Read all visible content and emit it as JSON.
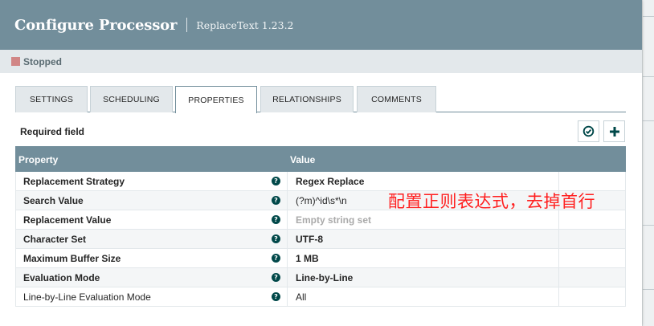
{
  "header": {
    "title": "Configure Processor",
    "subtitle": "ReplaceText 1.23.2"
  },
  "status": {
    "label": "Stopped",
    "color": "#d18686"
  },
  "tabs": [
    {
      "label": "SETTINGS"
    },
    {
      "label": "SCHEDULING"
    },
    {
      "label": "PROPERTIES",
      "active": true
    },
    {
      "label": "RELATIONSHIPS"
    },
    {
      "label": "COMMENTS"
    }
  ],
  "properties_panel": {
    "required_label": "Required field",
    "columns": {
      "property": "Property",
      "value": "Value"
    },
    "rows": [
      {
        "name": "Replacement Strategy",
        "value": "Regex Replace"
      },
      {
        "name": "Search Value",
        "value": "(?m)^id\\s*\\n"
      },
      {
        "name": "Replacement Value",
        "value": "Empty string set"
      },
      {
        "name": "Character Set",
        "value": "UTF-8"
      },
      {
        "name": "Maximum Buffer Size",
        "value": "1 MB"
      },
      {
        "name": "Evaluation Mode",
        "value": "Line-by-Line"
      },
      {
        "name": "Line-by-Line Evaluation Mode",
        "value": "All"
      }
    ]
  },
  "annotation": "配置正则表达式，去掉首行",
  "colors": {
    "header_bg": "#728e9b",
    "help_icon": "#004849",
    "annotation": "#ff2020"
  }
}
